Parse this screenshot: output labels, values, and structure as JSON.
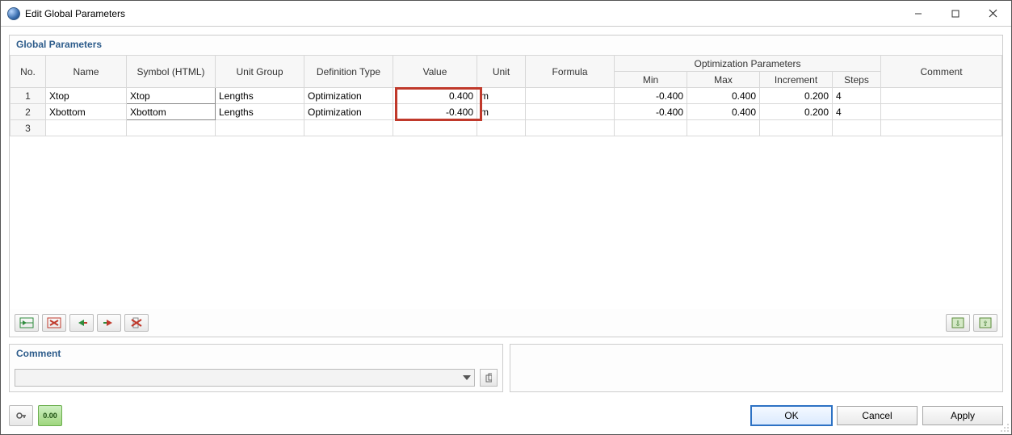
{
  "window": {
    "title": "Edit Global Parameters"
  },
  "panels": {
    "main_header": "Global Parameters",
    "comment_header": "Comment"
  },
  "grid": {
    "group_header": "Optimization Parameters",
    "columns": {
      "no": "No.",
      "name": "Name",
      "symbol": "Symbol (HTML)",
      "unit_group": "Unit Group",
      "def_type": "Definition Type",
      "value": "Value",
      "unit": "Unit",
      "formula": "Formula",
      "min": "Min",
      "max": "Max",
      "increment": "Increment",
      "steps": "Steps",
      "comment": "Comment"
    },
    "rows": [
      {
        "no": "1",
        "name": "Xtop",
        "symbol": "Xtop",
        "unit_group": "Lengths",
        "def_type": "Optimization",
        "value": "0.400",
        "unit": "m",
        "formula": "",
        "min": "-0.400",
        "max": "0.400",
        "increment": "0.200",
        "steps": "4",
        "comment": ""
      },
      {
        "no": "2",
        "name": "Xbottom",
        "symbol": "Xbottom",
        "unit_group": "Lengths",
        "def_type": "Optimization",
        "value": "-0.400",
        "unit": "m",
        "formula": "",
        "min": "-0.400",
        "max": "0.400",
        "increment": "0.200",
        "steps": "4",
        "comment": ""
      },
      {
        "no": "3",
        "name": "",
        "symbol": "",
        "unit_group": "",
        "def_type": "",
        "value": "",
        "unit": "",
        "formula": "",
        "min": "",
        "max": "",
        "increment": "",
        "steps": "",
        "comment": ""
      }
    ]
  },
  "comment": {
    "value": ""
  },
  "buttons": {
    "ok": "OK",
    "cancel": "Cancel",
    "apply": "Apply"
  },
  "icons": {
    "units_badge": "0.00"
  }
}
